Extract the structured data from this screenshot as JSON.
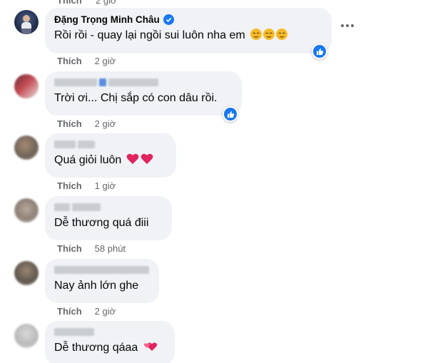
{
  "top_partial": {
    "like_label": "Thích",
    "time": "2 giờ"
  },
  "comments": [
    {
      "author": "Đặng Trọng Minh Châu",
      "text": "Rồi rồi - quay lại ngồi sui luôn nha em",
      "like_label": "Thích",
      "time": "2 giờ",
      "reaction": "like-icon",
      "emoji": "relieved-face-emoji x3"
    },
    {
      "author": "",
      "text": "Trời ơi... Chị sắp có con dâu rồi.",
      "like_label": "Thích",
      "time": "2 giờ",
      "reaction": "like-icon"
    },
    {
      "author": "",
      "text": "Quá giỏi luôn",
      "like_label": "Thích",
      "time": "1 giờ",
      "emoji": "red-heart-emoji x2"
    },
    {
      "author": "",
      "text": "Dễ thương quá điii",
      "like_label": "Thích",
      "time": "58 phút"
    },
    {
      "author": "",
      "text": "Nay ảnh lớn ghe",
      "like_label": "Thích",
      "time": "2 giờ"
    },
    {
      "author": "",
      "text": "Dễ thương qáaa",
      "emoji": "two-hearts-emoji"
    }
  ],
  "colors": {
    "bubble": "#f0f2f5",
    "meta": "#65676b",
    "accent": "#1877f2"
  }
}
